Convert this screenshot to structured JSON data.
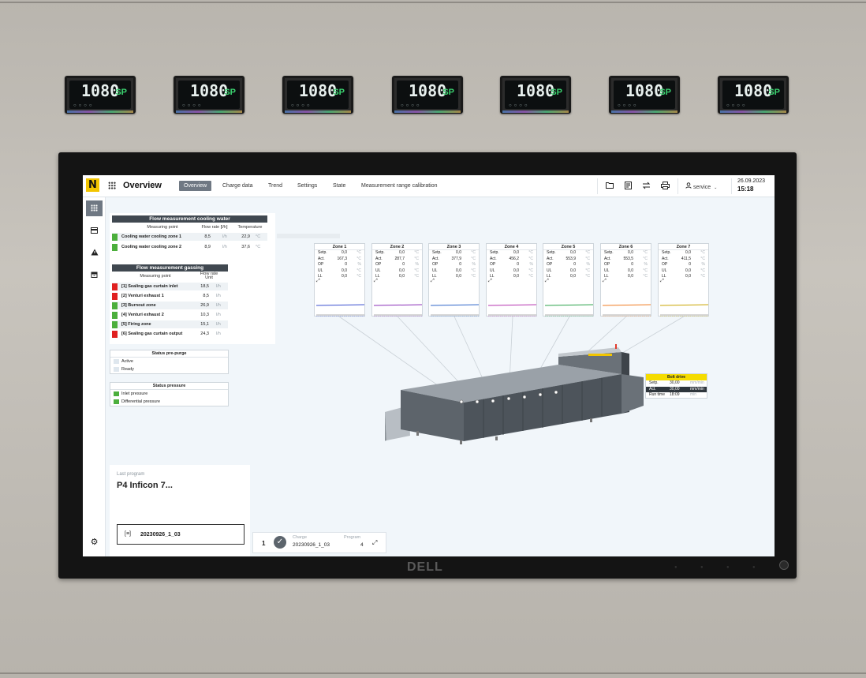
{
  "controllers": [
    {
      "display": "1080",
      "mode": "SP"
    },
    {
      "display": "1080",
      "mode": "SP"
    },
    {
      "display": "1080",
      "mode": "SP"
    },
    {
      "display": "1080",
      "mode": "SP"
    },
    {
      "display": "1080",
      "mode": "SP"
    },
    {
      "display": "1080",
      "mode": "SP"
    },
    {
      "display": "1080",
      "mode": "SP"
    }
  ],
  "monitor": {
    "brand": "DELL"
  },
  "topbar": {
    "logo": "N",
    "title": "Overview",
    "tabs": [
      "Overview",
      "Charge data",
      "Trend",
      "Settings",
      "State",
      "Measurement range calibration"
    ],
    "active_tab": "Overview",
    "icons": [
      "folder-icon",
      "notes-icon",
      "transfer-icon",
      "print-icon"
    ],
    "user": "service",
    "date": "26.09.2023",
    "time": "15:18"
  },
  "sidebar": {
    "items": [
      "grid-icon",
      "panel-icon",
      "warning-icon",
      "archive-icon"
    ],
    "settings": "gear-icon"
  },
  "cooling_water": {
    "title": "Flow measurement cooling water",
    "headers": [
      "Measuring point",
      "Flow rate [l/h]",
      "Temperature"
    ],
    "rows": [
      {
        "label": "Cooling water cooling zone 1",
        "flow": "8,5",
        "flow_unit": "l/h",
        "temp": "22,9",
        "temp_unit": "°C",
        "color": "#4caf3c"
      },
      {
        "label": "Cooling water cooling zone 2",
        "flow": "8,9",
        "flow_unit": "l/h",
        "temp": "37,6",
        "temp_unit": "°C",
        "color": "#4caf3c"
      }
    ]
  },
  "gassing": {
    "title": "Flow measurement gassing",
    "headers": [
      "Measuring point",
      "Flow rate",
      "Unit"
    ],
    "rows": [
      {
        "label": "[1] Sealing gas curtain inlet",
        "value": "18,5",
        "unit": "l/h",
        "color": "#e02020"
      },
      {
        "label": "[2] Venturi exhaust 1",
        "value": "8,5",
        "unit": "l/h",
        "color": "#e02020"
      },
      {
        "label": "[3] Burnout zone",
        "value": "26,9",
        "unit": "l/h",
        "color": "#4caf3c"
      },
      {
        "label": "[4] Venturi exhaust 2",
        "value": "10,3",
        "unit": "l/h",
        "color": "#4caf3c"
      },
      {
        "label": "[5] Firing zone",
        "value": "15,1",
        "unit": "l/h",
        "color": "#4caf3c"
      },
      {
        "label": "[6] Sealing gas curtain output",
        "value": "24,3",
        "unit": "l/h",
        "color": "#e02020"
      }
    ]
  },
  "status_prepurge": {
    "title": "Status pre-purge",
    "items": [
      {
        "label": "Active",
        "color": "#dfe7ee"
      },
      {
        "label": "Ready",
        "color": "#dfe7ee"
      }
    ]
  },
  "status_pressure": {
    "title": "Status pressure",
    "items": [
      {
        "label": "Inlet pressure",
        "color": "#4caf3c"
      },
      {
        "label": "Differential pressure",
        "color": "#4caf3c"
      }
    ]
  },
  "zones": [
    {
      "title": "Zone 1",
      "rows": [
        [
          "Setp.",
          "0,0",
          "°C"
        ],
        [
          "Act.",
          "167,3",
          "°C"
        ],
        [
          "OP",
          "0",
          "%"
        ],
        [
          "UL",
          "0,0",
          "°C"
        ],
        [
          "LL",
          "0,0",
          "°C"
        ]
      ],
      "color": "#3a4fcf"
    },
    {
      "title": "Zone 2",
      "rows": [
        [
          "Setp.",
          "0,0",
          "°C"
        ],
        [
          "Act.",
          "287,7",
          "°C"
        ],
        [
          "OP",
          "0",
          "%"
        ],
        [
          "UL",
          "0,0",
          "°C"
        ],
        [
          "LL",
          "0,0",
          "°C"
        ]
      ],
      "color": "#8a2fb8"
    },
    {
      "title": "Zone 3",
      "rows": [
        [
          "Setp.",
          "0,0",
          "°C"
        ],
        [
          "Act.",
          "377,9",
          "°C"
        ],
        [
          "OP",
          "0",
          "%"
        ],
        [
          "UL",
          "0,0",
          "°C"
        ],
        [
          "LL",
          "0,0",
          "°C"
        ]
      ],
      "color": "#2f66c9"
    },
    {
      "title": "Zone 4",
      "rows": [
        [
          "Setp.",
          "0,0",
          "°C"
        ],
        [
          "Act.",
          "456,2",
          "°C"
        ],
        [
          "OP",
          "0",
          "%"
        ],
        [
          "UL",
          "0,0",
          "°C"
        ],
        [
          "LL",
          "0,0",
          "°C"
        ]
      ],
      "color": "#b534b0"
    },
    {
      "title": "Zone 5",
      "rows": [
        [
          "Setp.",
          "0,0",
          "°C"
        ],
        [
          "Act.",
          "553,9",
          "°C"
        ],
        [
          "OP",
          "0",
          "%"
        ],
        [
          "UL",
          "0,0",
          "°C"
        ],
        [
          "LL",
          "0,0",
          "°C"
        ]
      ],
      "color": "#2aa24a"
    },
    {
      "title": "Zone 6",
      "rows": [
        [
          "Setp.",
          "0,0",
          "°C"
        ],
        [
          "Act.",
          "553,5",
          "°C"
        ],
        [
          "OP",
          "0",
          "%"
        ],
        [
          "UL",
          "0,0",
          "°C"
        ],
        [
          "LL",
          "0,0",
          "°C"
        ]
      ],
      "color": "#f07b21"
    },
    {
      "title": "Zone 7",
      "rows": [
        [
          "Setp.",
          "0,0",
          "°C"
        ],
        [
          "Act.",
          "411,5",
          "°C"
        ],
        [
          "OP",
          "0",
          "%"
        ],
        [
          "UL",
          "0,0",
          "°C"
        ],
        [
          "LL",
          "0,0",
          "°C"
        ]
      ],
      "color": "#c9a500"
    }
  ],
  "bolt_drive": {
    "title": "Bolt drive",
    "rows": [
      {
        "k": "Setp.",
        "v": "30,00",
        "u": "mm/min",
        "dark": false
      },
      {
        "k": "Act.",
        "v": "30,00",
        "u": "mm/min",
        "dark": true
      },
      {
        "k": "Run time",
        "v": "18:09",
        "u": "min",
        "dark": false
      }
    ]
  },
  "last_program": {
    "label": "Last program",
    "name": "P4 Inficon 7...",
    "charge_field": "20230926_1_03"
  },
  "charge_bar": {
    "count": "1",
    "charge_label": "Charge",
    "charge_value": "20230926_1_03",
    "program_label": "Program",
    "program_value": "4"
  }
}
